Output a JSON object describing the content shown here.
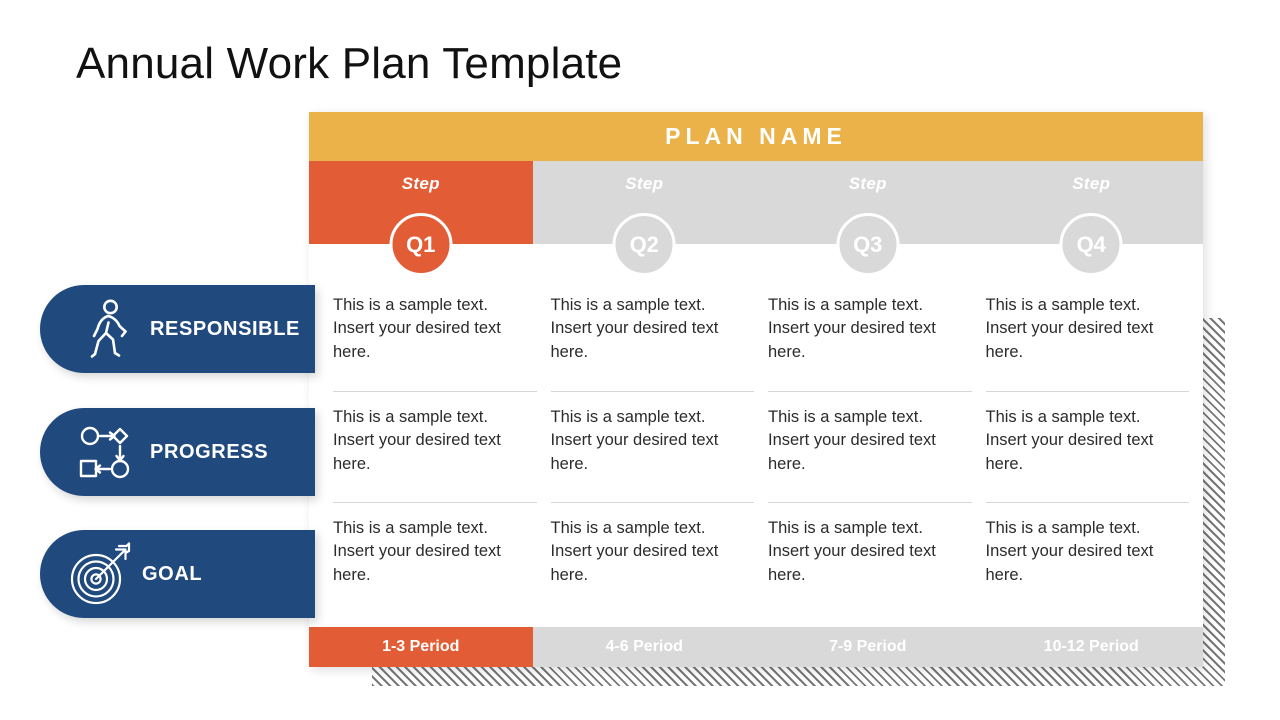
{
  "slide": {
    "title": "Annual Work Plan Template"
  },
  "colors": {
    "amber": "#EAB248",
    "orange": "#E25C35",
    "gray": "#D9D9D9",
    "navy": "#20497E",
    "white": "#FFFFFF"
  },
  "card": {
    "header_label": "PLAN NAME",
    "steps": [
      {
        "step_label": "Step",
        "quarter": "Q1",
        "active": true
      },
      {
        "step_label": "Step",
        "quarter": "Q2",
        "active": false
      },
      {
        "step_label": "Step",
        "quarter": "Q3",
        "active": false
      },
      {
        "step_label": "Step",
        "quarter": "Q4",
        "active": false
      }
    ],
    "periods": [
      {
        "label": "1-3 Period",
        "active": true
      },
      {
        "label": "4-6 Period",
        "active": false
      },
      {
        "label": "7-9 Period",
        "active": false
      },
      {
        "label": "10-12 Period",
        "active": false
      }
    ],
    "rows": [
      {
        "category": "RESPONSIBLE",
        "cells": [
          "This is a sample text. Insert your desired text here.",
          "This is a sample text. Insert your desired text here.",
          "This is a sample text. Insert your desired text here.",
          "This is a sample text. Insert your desired text here."
        ]
      },
      {
        "category": "PROGRESS",
        "cells": [
          "This is a sample text. Insert your desired text here.",
          "This is a sample text. Insert your desired text here.",
          "This is a sample text. Insert your desired text here.",
          "This is a sample text. Insert your desired text here."
        ]
      },
      {
        "category": "GOAL",
        "cells": [
          "This is a sample text. Insert your desired text here.",
          "This is a sample text. Insert your desired text here.",
          "This is a sample text. Insert your desired text here.",
          "This is a sample text. Insert your desired text here."
        ]
      }
    ]
  },
  "sidebar": {
    "pills": [
      {
        "label": "RESPONSIBLE",
        "icon": "walking-person-icon"
      },
      {
        "label": "PROGRESS",
        "icon": "flowchart-icon"
      },
      {
        "label": "GOAL",
        "icon": "target-arrow-icon"
      }
    ]
  }
}
